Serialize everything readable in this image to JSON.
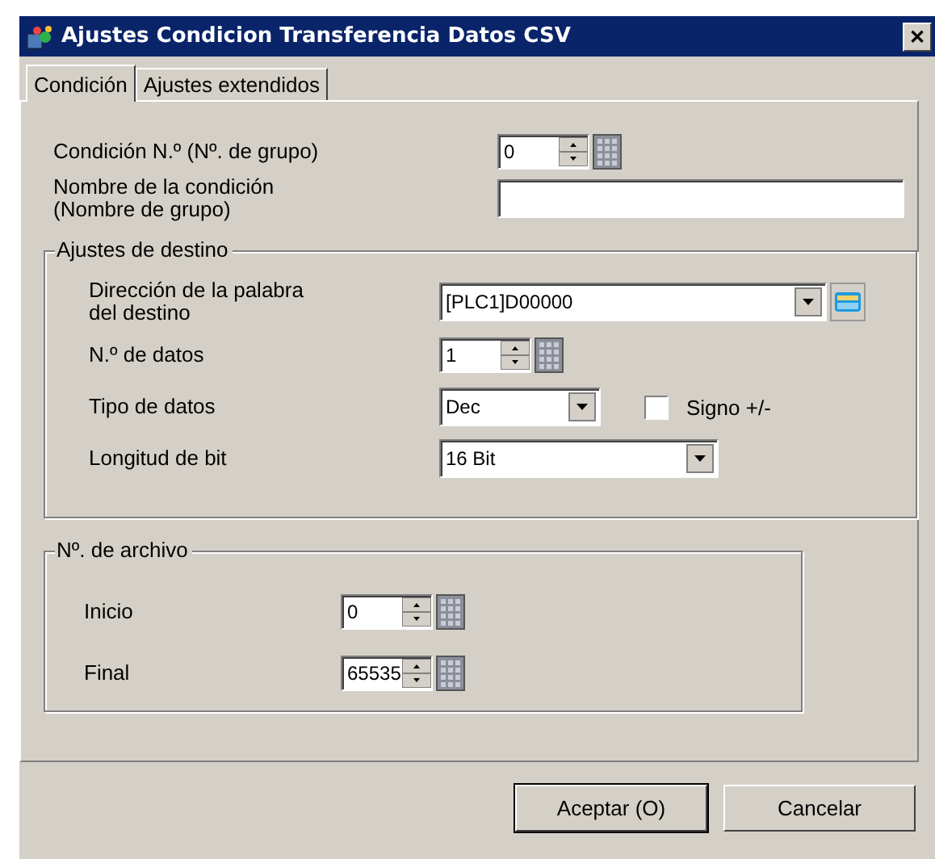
{
  "window": {
    "title": "Ajustes Condicion Transferencia Datos CSV",
    "close": "✕"
  },
  "tabs": [
    {
      "label": "Condición",
      "selected": true
    },
    {
      "label": "Ajustes extendidos",
      "selected": false
    }
  ],
  "top_rows": [
    {
      "kind": "spinner",
      "label": "Condición N.º (Nº. de grupo)",
      "value": "0"
    },
    {
      "kind": "text",
      "label": "Nombre de la condición\n(Nombre de grupo)"
    }
  ],
  "destination": {
    "title": "Ajustes de destino",
    "rows": [
      {
        "kind": "address",
        "label": "Dirección de la palabra\ndel destino",
        "value": "[PLC1]D00000"
      },
      {
        "kind": "spinner",
        "label": "N.º de datos",
        "value": "1"
      },
      {
        "kind": "combo",
        "label": "Tipo de datos",
        "value": "Dec",
        "checkbox": {
          "label": "Signo +/-",
          "checked": false
        }
      },
      {
        "kind": "combo-wide",
        "label": "Longitud de bit",
        "value": "16 Bit"
      }
    ]
  },
  "file_number": {
    "title": "Nº. de archivo",
    "rows": [
      {
        "kind": "spinner",
        "label": "Inicio",
        "value": "0"
      },
      {
        "kind": "spinner",
        "label": "Final",
        "value": "65535"
      }
    ]
  },
  "buttons": [
    {
      "label": "Aceptar (O)",
      "default": true
    },
    {
      "label": "Cancelar",
      "default": false
    }
  ]
}
